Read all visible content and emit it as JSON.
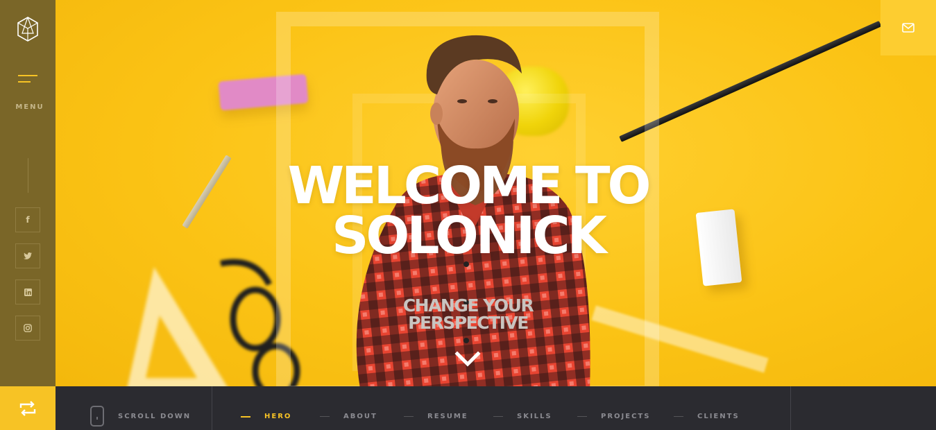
{
  "sidebar": {
    "menu_label": "MENU",
    "social": [
      {
        "name": "facebook",
        "glyph": "f"
      },
      {
        "name": "twitter",
        "glyph": "t"
      },
      {
        "name": "linkedin",
        "glyph": "in"
      },
      {
        "name": "instagram",
        "glyph": "◎"
      }
    ]
  },
  "hero": {
    "title_line1": "WELCOME TO",
    "title_line2": "SOLONICK",
    "subtitle_line1": "CHANGE YOUR",
    "subtitle_line2": "PERSPECTIVE"
  },
  "bottom": {
    "scroll_label": "SCROLL DOWN",
    "nav": [
      {
        "label": "HERO",
        "active": true
      },
      {
        "label": "ABOUT",
        "active": false
      },
      {
        "label": "RESUME",
        "active": false
      },
      {
        "label": "SKILLS",
        "active": false
      },
      {
        "label": "PROJECTS",
        "active": false
      },
      {
        "label": "CLIENTS",
        "active": false
      }
    ]
  },
  "icons": {
    "logo": "polyhedron-logo-icon",
    "mail": "envelope-icon",
    "share": "repeat-icon",
    "scroll": "mouse-icon",
    "down": "chevron-down-icon"
  },
  "colors": {
    "accent": "#f7c325",
    "hero_bg": "#fcc419",
    "sidebar_bg": "#7a6628",
    "bottom_bg": "#2b2b30"
  }
}
